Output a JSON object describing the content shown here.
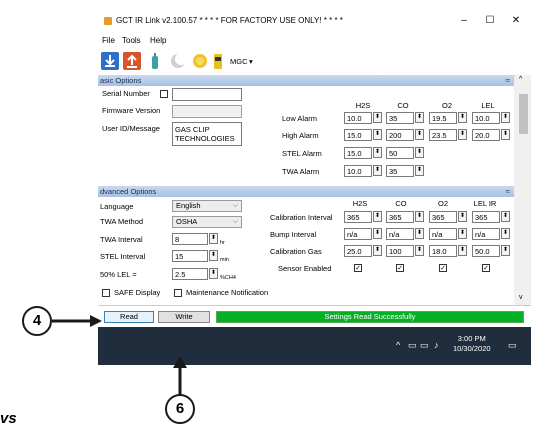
{
  "window": {
    "title": "GCT IR Link  v2.100.57 * * * * FOR FACTORY USE ONLY!  * * * *",
    "minimize": "–",
    "maximize": "☐",
    "close": "✕"
  },
  "menu": [
    "File",
    "Tools",
    "Help"
  ],
  "toolbar": {
    "device_label": "MGC",
    "device_arrow": "▾"
  },
  "basic": {
    "header": "asic Options",
    "serial_label": "Serial Number",
    "serial_value": "",
    "firmware_label": "Firmware Version",
    "firmware_value": "",
    "user_label": "User ID/Message",
    "user_value_line1": "GAS CLIP",
    "user_value_line2": "TECHNOLOGIES",
    "gas_headers": [
      "H2S",
      "CO",
      "O2",
      "LEL"
    ],
    "rows": [
      {
        "label": "Low Alarm",
        "values": [
          "10.0",
          "35",
          "19.5",
          "10.0"
        ]
      },
      {
        "label": "High Alarm",
        "values": [
          "15.0",
          "200",
          "23.5",
          "20.0"
        ]
      },
      {
        "label": "STEL Alarm",
        "values": [
          "15.0",
          "50"
        ]
      },
      {
        "label": "TWA Alarm",
        "values": [
          "10.0",
          "35"
        ]
      }
    ]
  },
  "advanced": {
    "header": "dvanced Options",
    "language_label": "Language",
    "language_value": "English",
    "twa_method_label": "TWA Method",
    "twa_method_value": "OSHA",
    "twa_interval_label": "TWA Interval",
    "twa_interval_value": "8",
    "twa_interval_unit": "hr",
    "stel_interval_label": "STEL Interval",
    "stel_interval_value": "15",
    "stel_interval_unit": "min",
    "lel_label": "50% LEL =",
    "lel_value": "2.5",
    "lel_unit": "%CH4",
    "safe_display_label": "SAFE Display",
    "maintenance_label": "Maintenance Notification",
    "gas_headers": [
      "H2S",
      "CO",
      "O2",
      "LEL IR"
    ],
    "rows": [
      {
        "label": "Calibration Interval",
        "values": [
          "365",
          "365",
          "365",
          "365"
        ]
      },
      {
        "label": "Bump Interval",
        "values": [
          "n/a",
          "n/a",
          "n/a",
          "n/a"
        ]
      },
      {
        "label": "Calibration Gas",
        "values": [
          "25.0",
          "100",
          "18.0",
          "50.0"
        ]
      }
    ],
    "sensor_enabled_label": "Sensor Enabled"
  },
  "bottom": {
    "read_label": "Read",
    "write_label": "Write",
    "status": "Settings Read Successfully"
  },
  "taskbar": {
    "time": "3:00 PM",
    "date": "10/30/2020"
  },
  "callouts": {
    "read": "4",
    "write": "6"
  },
  "edge_text": "vs"
}
